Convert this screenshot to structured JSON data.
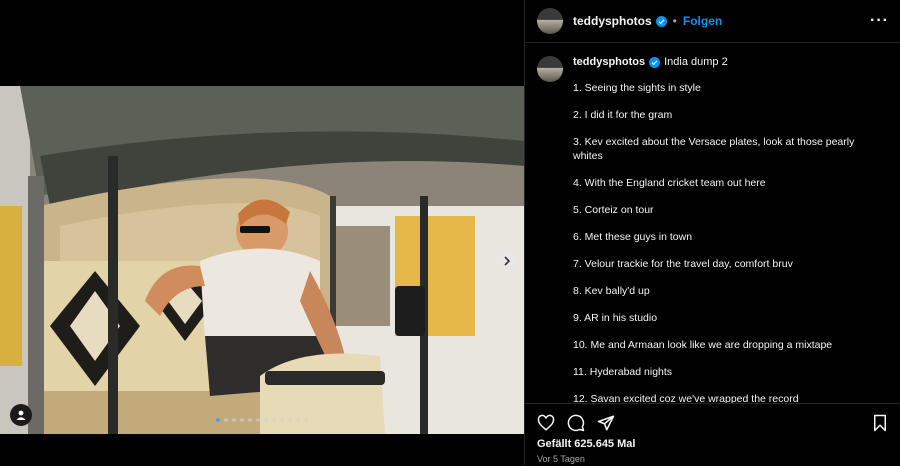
{
  "post": {
    "username": "teddysphotos",
    "follow_label": "Folgen",
    "separator": "•",
    "more_label": "···"
  },
  "caption": {
    "username": "teddysphotos",
    "title": "India dump 2",
    "items": [
      "1. Seeing the sights in style",
      "2. I did it for the gram",
      "3. Kev excited about the Versace plates, look at those pearly whites",
      "4. With the England cricket team out here",
      "5. Corteiz on tour",
      "6. Met these guys in town",
      "7. Velour trackie for the travel day, comfort bruv",
      "8. Kev bally'd up",
      "9. AR in his studio",
      "10. Me and Armaan look like we are dropping a mixtape",
      "11. Hyderabad nights",
      "12. Savan excited coz we've wrapped the record"
    ]
  },
  "engagement": {
    "likes_text": "Gefällt 625.645 Mal",
    "date_text": "Vor 5 Tagen"
  },
  "carousel": {
    "total": 12,
    "active_index": 0
  },
  "icons": {
    "verified": "verified-badge-icon",
    "like": "heart-icon",
    "comment": "comment-icon",
    "share": "share-icon",
    "save": "bookmark-icon",
    "next": "chevron-right-icon",
    "tag": "user-tag-icon"
  },
  "colors": {
    "accent": "#0095f6",
    "background": "#000000",
    "border": "#262626"
  }
}
